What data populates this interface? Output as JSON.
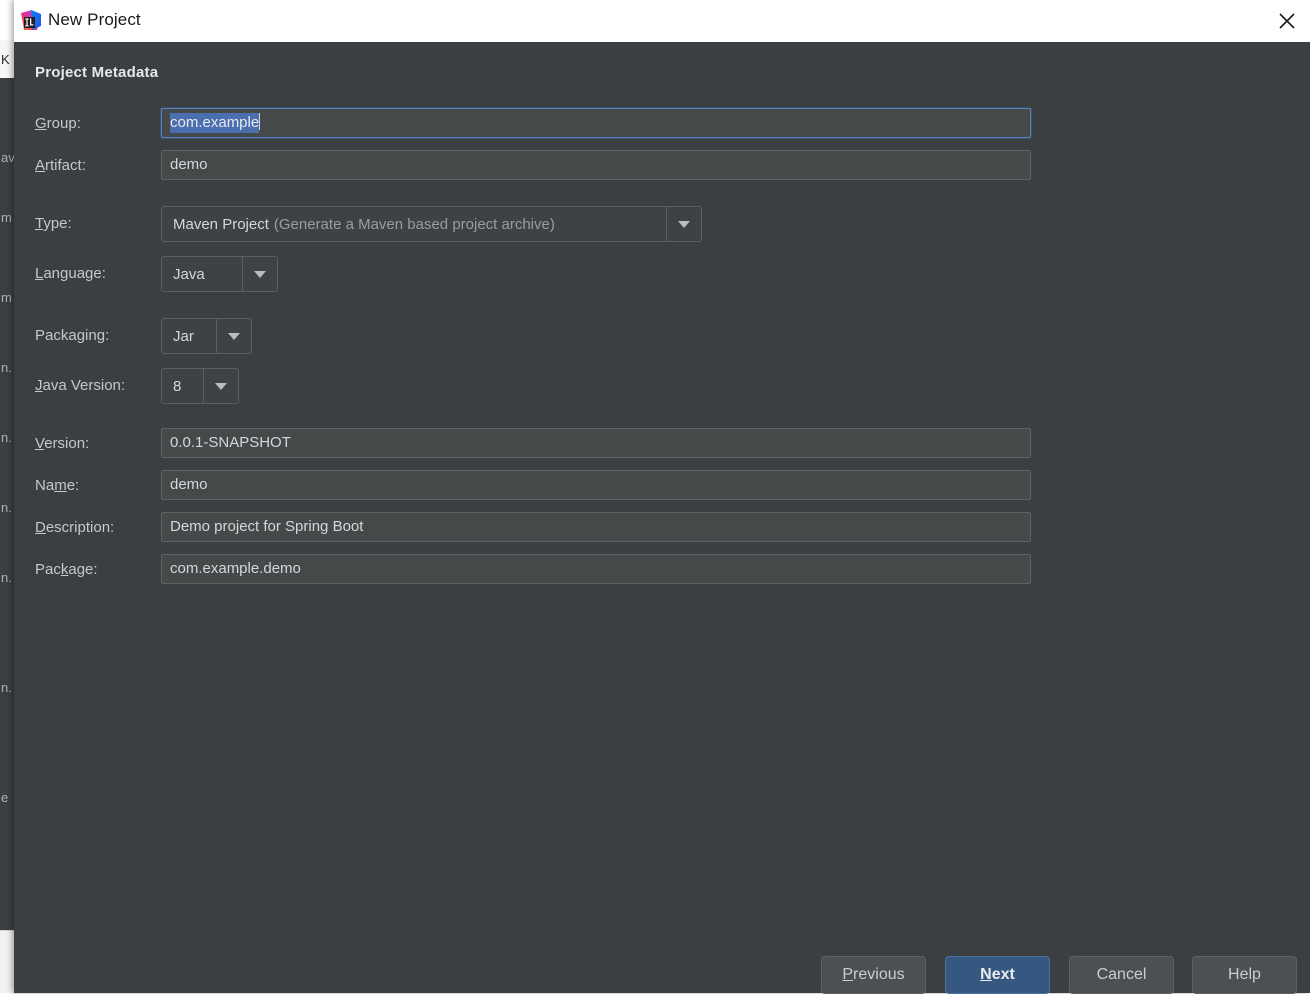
{
  "window": {
    "title": "New Project",
    "icon": "intellij-idea-logo",
    "close_icon": "close-icon"
  },
  "content": {
    "section_title": "Project Metadata"
  },
  "fields": {
    "group": {
      "label": "Group:",
      "mnemonic": "G",
      "value": "com.example",
      "selected": true,
      "focused": true
    },
    "artifact": {
      "label": "Artifact:",
      "mnemonic": "A",
      "value": "demo"
    },
    "type": {
      "label": "Type:",
      "mnemonic": "T",
      "value": "Maven Project",
      "value_hint": "(Generate a Maven based project archive)",
      "arrow_icon": "chevron-down-icon"
    },
    "language": {
      "label": "Language:",
      "mnemonic": "L",
      "value": "Java",
      "arrow_icon": "chevron-down-icon"
    },
    "packaging": {
      "label": "Packaging:",
      "mnemonic": "g",
      "value": "Jar",
      "arrow_icon": "chevron-down-icon"
    },
    "java_version": {
      "label": "Java Version:",
      "mnemonic": "J",
      "value": "8",
      "arrow_icon": "chevron-down-icon"
    },
    "version": {
      "label": "Version:",
      "mnemonic": "V",
      "value": "0.0.1-SNAPSHOT"
    },
    "name": {
      "label": "Name:",
      "mnemonic": "m",
      "value": "demo"
    },
    "description": {
      "label": "Description:",
      "mnemonic": "D",
      "value": "Demo project for Spring Boot"
    },
    "package": {
      "label": "Package:",
      "mnemonic": "k",
      "value": "com.example.demo"
    }
  },
  "buttons": {
    "previous": {
      "label_pre": "",
      "mnemonic": "P",
      "label_post": "revious"
    },
    "next": {
      "label_pre": "",
      "mnemonic": "N",
      "label_post": "ext",
      "is_default": true
    },
    "cancel": {
      "label": "Cancel"
    },
    "help": {
      "label": "Help"
    }
  },
  "colors": {
    "dialog_background": "#3c3f41",
    "titlebar_background": "#ffffff",
    "input_background": "#45494a",
    "focus_border": "#5781c4",
    "selection_background": "#4b6eaf",
    "default_button_background": "#365880",
    "label_text": "#c4c8cb"
  }
}
